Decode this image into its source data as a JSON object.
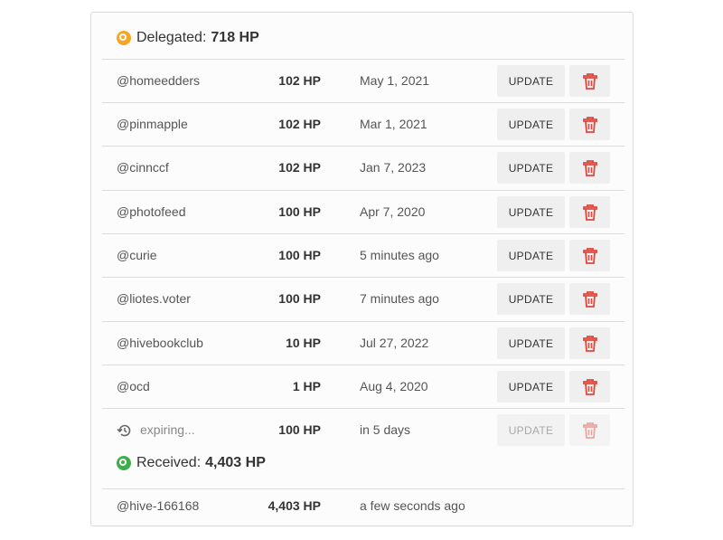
{
  "delegated": {
    "title": "Delegated:",
    "total": "718 HP",
    "update_label": "UPDATE",
    "rows": [
      {
        "user": "@homeedders",
        "hp": "102 HP",
        "date": "May 1, 2021"
      },
      {
        "user": "@pinmapple",
        "hp": "102 HP",
        "date": "Mar 1, 2021"
      },
      {
        "user": "@cinnccf",
        "hp": "102 HP",
        "date": "Jan 7, 2023"
      },
      {
        "user": "@photofeed",
        "hp": "100 HP",
        "date": "Apr 7, 2020"
      },
      {
        "user": "@curie",
        "hp": "100 HP",
        "date": "5 minutes ago"
      },
      {
        "user": "@liotes.voter",
        "hp": "100 HP",
        "date": "7 minutes ago"
      },
      {
        "user": "@hivebookclub",
        "hp": "10 HP",
        "date": "Jul 27, 2022"
      },
      {
        "user": "@ocd",
        "hp": "1 HP",
        "date": "Aug 4, 2020"
      }
    ],
    "expiring": {
      "label": "expiring...",
      "hp": "100 HP",
      "date": "in 5 days"
    }
  },
  "received": {
    "title": "Received:",
    "total": "4,403 HP",
    "rows": [
      {
        "user": "@hive-166168",
        "hp": "4,403 HP",
        "date": "a few seconds ago"
      }
    ]
  },
  "colors": {
    "delegated_icon": "#f5a623",
    "received_icon": "#3fae4a",
    "delete_icon": "#e0483e"
  },
  "icons": {
    "delegated": "circle-ring-icon",
    "received": "circle-ring-icon",
    "delete": "trash-icon",
    "expiring": "history-icon"
  }
}
